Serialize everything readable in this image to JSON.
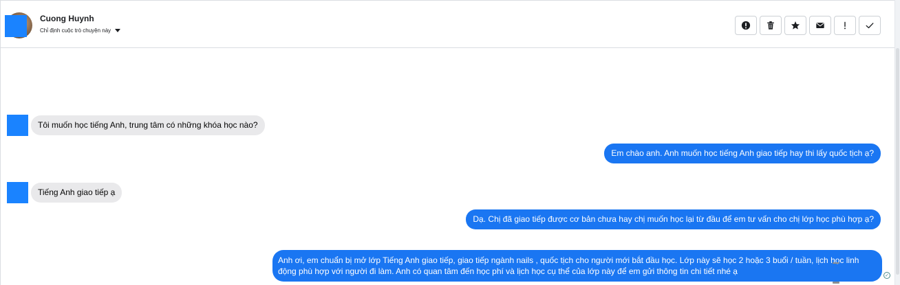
{
  "header": {
    "contact_name": "Cuong Huynh",
    "assign_label": "Chỉ định cuộc trò chuyện này",
    "toolbar_icons": [
      "alert-circle-icon",
      "trash-icon",
      "star-icon",
      "envelope-icon",
      "exclamation-icon",
      "check-icon"
    ]
  },
  "messages": [
    {
      "direction": "in",
      "text": "Tôi muốn học tiếng Anh, trung tâm có những khóa học nào?"
    },
    {
      "direction": "out",
      "text": "Em chào anh. Anh muốn học tiếng Anh giao tiếp hay thi lấy quốc tịch ạ?"
    },
    {
      "direction": "in",
      "text": "Tiếng Anh giao tiếp ạ"
    },
    {
      "direction": "out",
      "text": "Dạ. Chị đã giao tiếp được cơ bản chưa hay chị muốn học lại từ đầu để em tư vấn cho chị lớp học phù hợp ạ?"
    },
    {
      "direction": "out",
      "text": "Anh ơi, em chuẩn bị mở lớp Tiếng Anh giao tiếp, giao tiếp ngành nails , quốc tịch cho người mới bắt đầu học. Lớp này sẽ học 2 hoặc 3 buổi / tuần, lịch học linh động phù hợp với người đi làm. Anh có quan tâm đến học phí và lịch học cụ thể của lớp này để em  gửi thông tin chi tiết nhé ạ"
    }
  ],
  "colors": {
    "outgoing_bubble": "#1a76f2",
    "incoming_bubble": "#e9e9eb",
    "avatar_placeholder": "#1a83ff"
  }
}
